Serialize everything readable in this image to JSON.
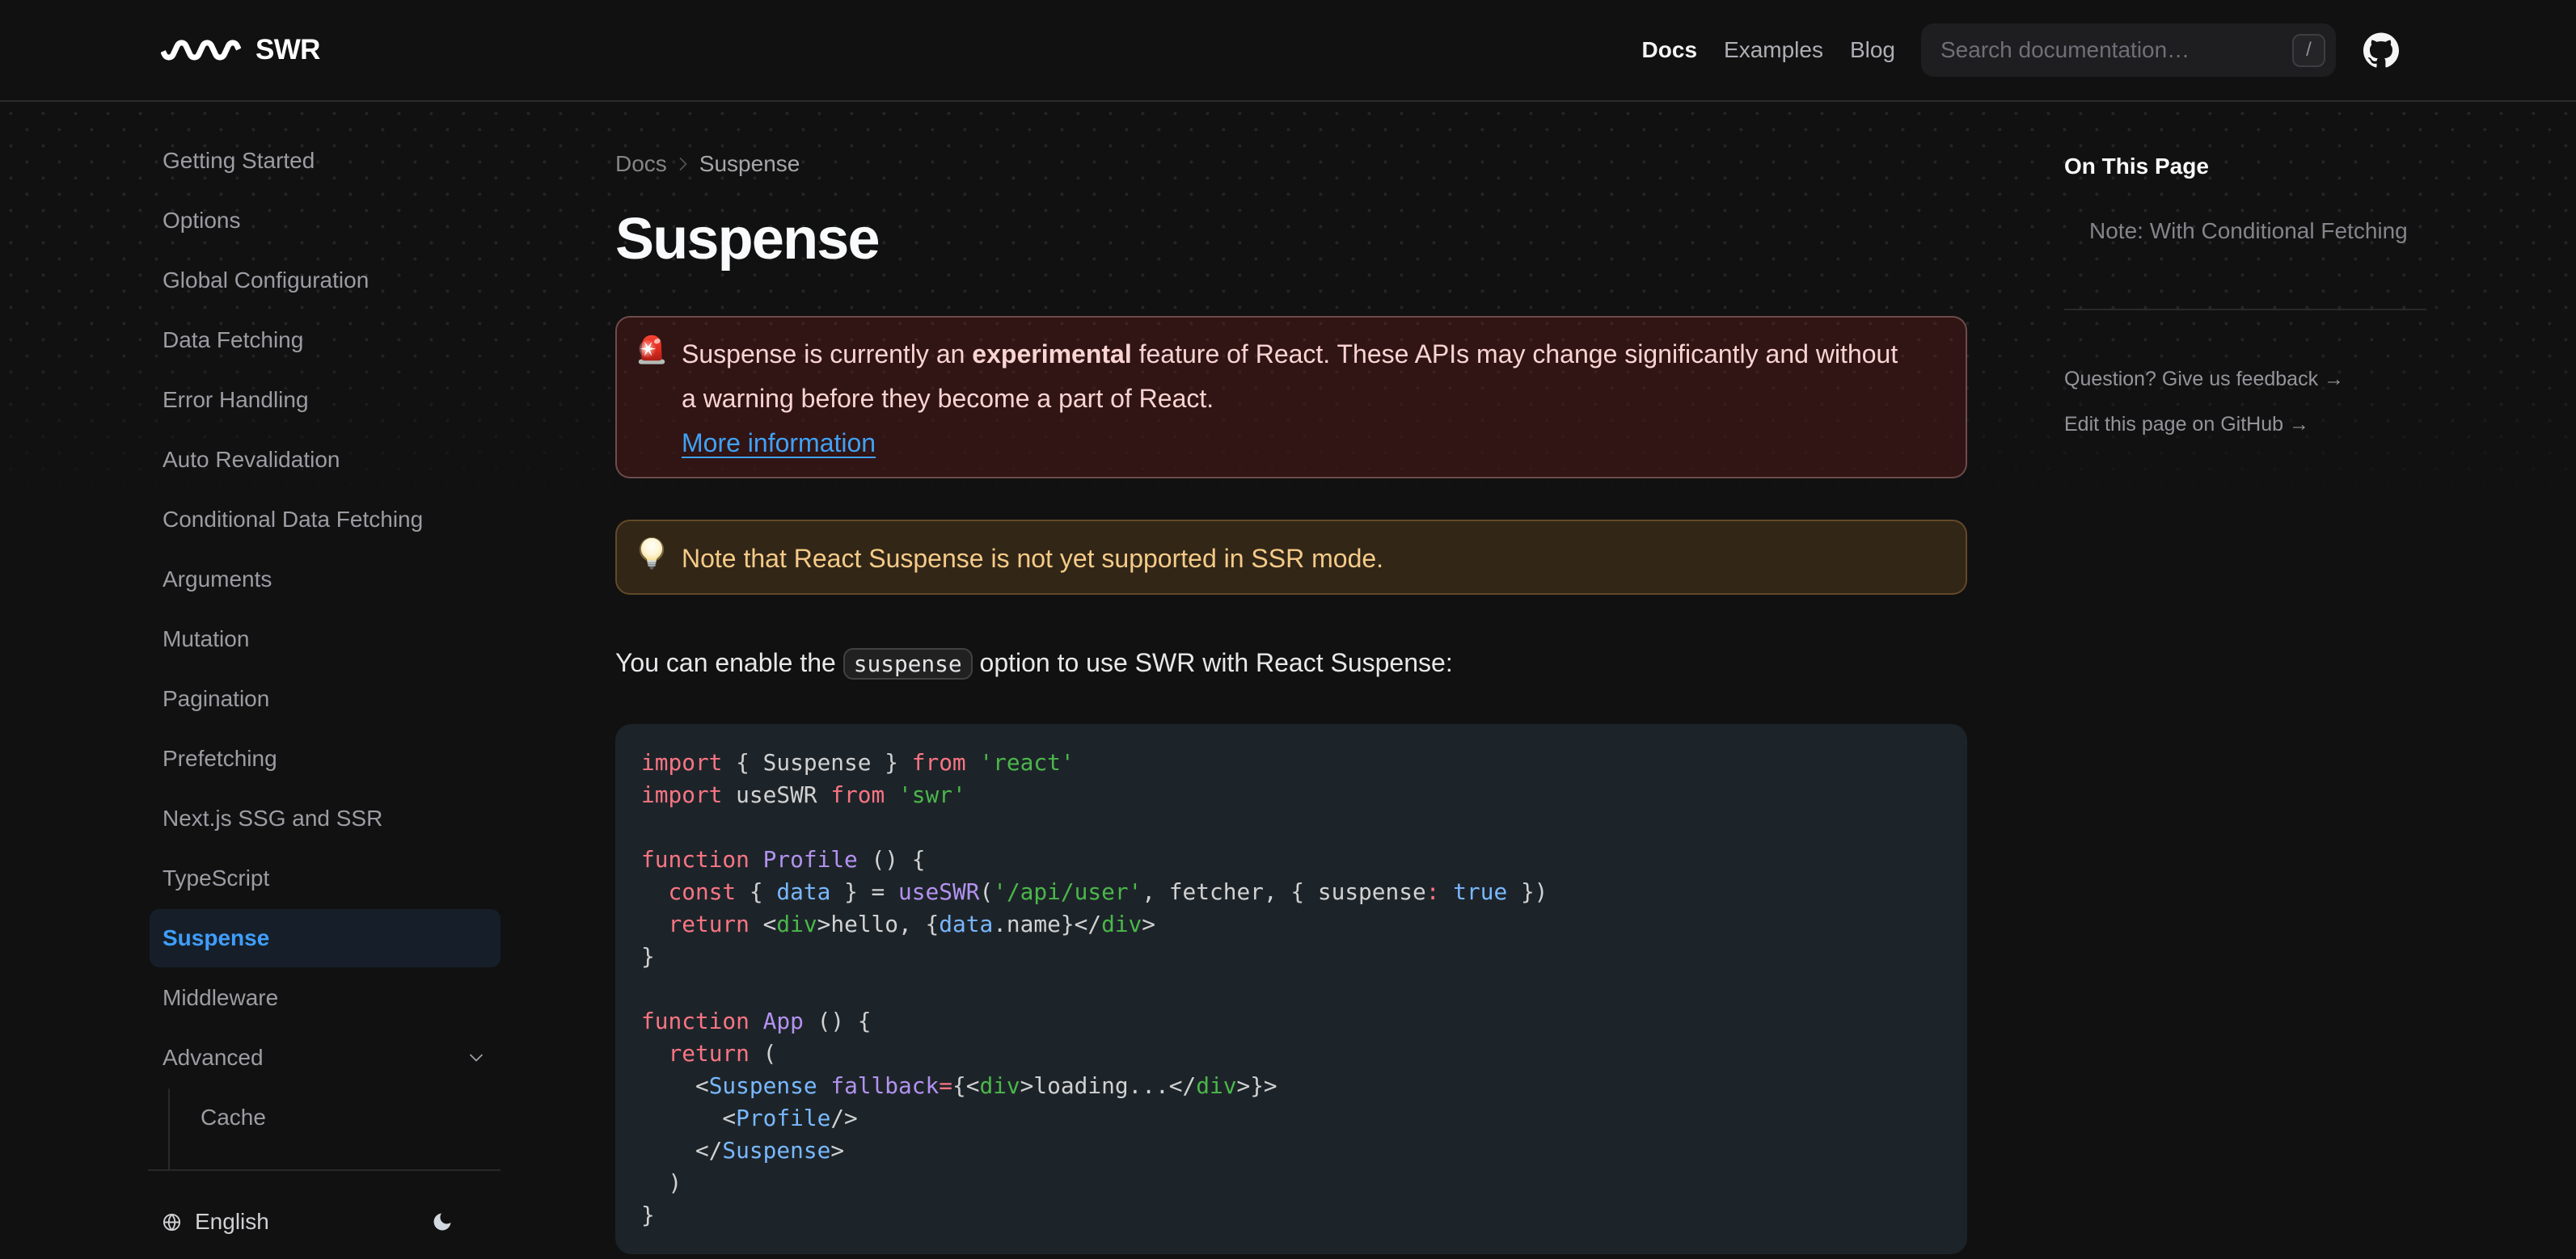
{
  "navbar": {
    "logo_text": "SWR",
    "links": [
      {
        "label": "Docs",
        "active": true
      },
      {
        "label": "Examples",
        "active": false
      },
      {
        "label": "Blog",
        "active": false
      }
    ],
    "search_placeholder": "Search documentation…",
    "search_kbd": "/"
  },
  "sidebar": {
    "items": [
      {
        "label": "Getting Started"
      },
      {
        "label": "Options"
      },
      {
        "label": "Global Configuration"
      },
      {
        "label": "Data Fetching"
      },
      {
        "label": "Error Handling"
      },
      {
        "label": "Auto Revalidation"
      },
      {
        "label": "Conditional Data Fetching"
      },
      {
        "label": "Arguments"
      },
      {
        "label": "Mutation"
      },
      {
        "label": "Pagination"
      },
      {
        "label": "Prefetching"
      },
      {
        "label": "Next.js SSG and SSR"
      },
      {
        "label": "TypeScript"
      },
      {
        "label": "Suspense",
        "active": true
      },
      {
        "label": "Middleware"
      },
      {
        "label": "Advanced",
        "expandable": true
      }
    ],
    "nested_items": [
      {
        "label": "Cache"
      }
    ],
    "footer_language": "English"
  },
  "breadcrumb": {
    "parent": "Docs",
    "current": "Suspense"
  },
  "page": {
    "title": "Suspense"
  },
  "callout_error": {
    "icon": "rotating-light-emoji",
    "text_before_bold": "Suspense is currently an ",
    "bold": "experimental",
    "text_after_bold": " feature of React. These APIs may change significantly and without\na warning before they become a part of React.",
    "link": "More information"
  },
  "callout_warning": {
    "icon": "light-bulb-emoji",
    "text": "Note that React Suspense is not yet supported in SSR mode."
  },
  "paragraph": {
    "before": "You can enable the ",
    "code": "suspense",
    "after": " option to use SWR with React Suspense:"
  },
  "code_block": {
    "language": "jsx",
    "lines": [
      [
        [
          "import",
          "k"
        ],
        [
          " { Suspense } ",
          "t"
        ],
        [
          "from",
          "k"
        ],
        [
          " ",
          "t"
        ],
        [
          "'react'",
          "s"
        ]
      ],
      [
        [
          "import",
          "k"
        ],
        [
          " useSWR ",
          "t"
        ],
        [
          "from",
          "k"
        ],
        [
          " ",
          "t"
        ],
        [
          "'swr'",
          "s"
        ]
      ],
      [],
      [
        [
          "function",
          "k"
        ],
        [
          " ",
          "t"
        ],
        [
          "Profile",
          "f"
        ],
        [
          " () {",
          "t"
        ]
      ],
      [
        [
          "  ",
          "t"
        ],
        [
          "const",
          "k"
        ],
        [
          " { ",
          "t"
        ],
        [
          "data",
          "c"
        ],
        [
          " } = ",
          "t"
        ],
        [
          "useSWR",
          "f"
        ],
        [
          "(",
          "t"
        ],
        [
          "'/api/user'",
          "s"
        ],
        [
          ", fetcher, { suspense",
          "t"
        ],
        [
          ":",
          "k"
        ],
        [
          " ",
          "t"
        ],
        [
          "true",
          "c"
        ],
        [
          " })",
          "t"
        ]
      ],
      [
        [
          "  ",
          "t"
        ],
        [
          "return",
          "k"
        ],
        [
          " <",
          "t"
        ],
        [
          "div",
          "s"
        ],
        [
          ">hello, {",
          "t"
        ],
        [
          "data",
          "c"
        ],
        [
          ".name}</",
          "t"
        ],
        [
          "div",
          "s"
        ],
        [
          ">",
          "t"
        ]
      ],
      [
        [
          "}",
          "t"
        ]
      ],
      [],
      [
        [
          "function",
          "k"
        ],
        [
          " ",
          "t"
        ],
        [
          "App",
          "f"
        ],
        [
          " () {",
          "t"
        ]
      ],
      [
        [
          "  ",
          "t"
        ],
        [
          "return",
          "k"
        ],
        [
          " (",
          "t"
        ]
      ],
      [
        [
          "    <",
          "t"
        ],
        [
          "Suspense",
          "c"
        ],
        [
          " ",
          "t"
        ],
        [
          "fallback",
          "f"
        ],
        [
          "=",
          "k"
        ],
        [
          "{<",
          "t"
        ],
        [
          "div",
          "s"
        ],
        [
          ">loading...</",
          "t"
        ],
        [
          "div",
          "s"
        ],
        [
          ">}>",
          "t"
        ]
      ],
      [
        [
          "      <",
          "t"
        ],
        [
          "Profile",
          "c"
        ],
        [
          "/>",
          "t"
        ]
      ],
      [
        [
          "    </",
          "t"
        ],
        [
          "Suspense",
          "c"
        ],
        [
          ">",
          "t"
        ]
      ],
      [
        [
          "  )",
          "t"
        ]
      ],
      [
        [
          "}",
          "t"
        ]
      ]
    ]
  },
  "toc": {
    "heading": "On This Page",
    "items": [
      "Note: With Conditional Fetching"
    ],
    "links": [
      "Question? Give us feedback →",
      "Edit this page on GitHub →"
    ]
  },
  "colors": {
    "background": "#111111",
    "primary_blue": "#3ba0ff",
    "error_bg": "#321515",
    "error_text": "#fecaca",
    "warning_bg": "#3f2b19",
    "warning_text": "#fbd38d",
    "code_bg": "#1d2429"
  }
}
